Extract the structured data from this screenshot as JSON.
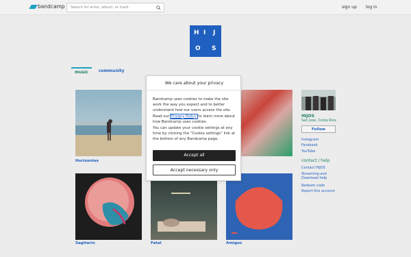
{
  "header": {
    "brand": "bandcamp",
    "search_placeholder": "Search for artist, album, or track",
    "signup": "sign up",
    "login": "log in"
  },
  "band_logo_letters": [
    "H",
    "I",
    "J",
    "O",
    "S"
  ],
  "tabs": {
    "music": "music",
    "community": "community"
  },
  "albums": [
    {
      "title": "Horizontes"
    },
    {
      "title": "Sagitario"
    },
    {
      "title": "Fatal"
    },
    {
      "title": "Amigos"
    }
  ],
  "sidebar": {
    "name": "HIJOS",
    "location": "San Jose, Costa Rica",
    "follow": "Follow",
    "social": [
      "Instagram",
      "Facebook",
      "YouTube"
    ],
    "contact_head": "contact / help",
    "contact_links": [
      "Contact HIJOS",
      "Streaming and Download help",
      "Redeem code",
      "Report this account"
    ]
  },
  "cookie_modal": {
    "title": "We care about your privacy",
    "p1_before": "Bandcamp uses cookies to make the site work the way you expect and to better understand how our users access the site. Read our ",
    "p1_link": "Privacy Policy",
    "p1_after": " to learn more about how Bandcamp uses cookies.",
    "p2": "You can update your cookie settings at any time by clicking the “Cookie settings” link at the bottom of any Bandcamp page.",
    "accept_all": "Accept all",
    "accept_necessary": "Accept necessary only"
  },
  "colors": {
    "accent": "#1da0c3",
    "link": "#1f5fbf",
    "green": "#1a7f63",
    "logo_bg": "#1f5fbf"
  }
}
